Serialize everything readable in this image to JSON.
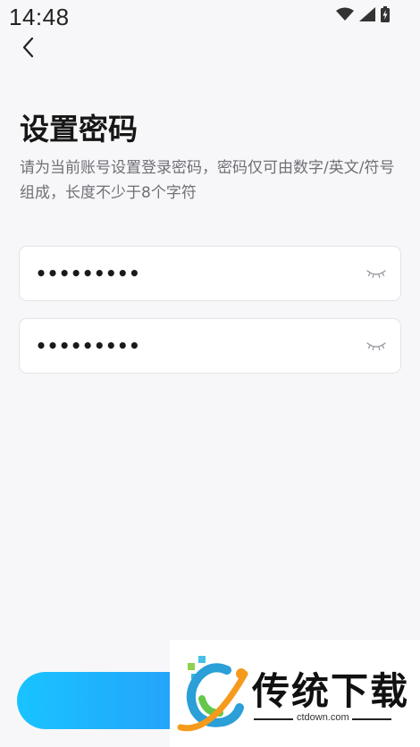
{
  "status_bar": {
    "time": "14:48",
    "icons": [
      "wifi-icon",
      "cell-signal-icon",
      "battery-icon"
    ]
  },
  "nav": {
    "back_icon": "chevron-left-icon"
  },
  "page": {
    "title": "设置密码",
    "description": "请为当前账号设置登录密码，密码仅可由数字/英文/符号组成，长度不少于8个字符"
  },
  "form": {
    "password_field": {
      "value": "•••••••••",
      "toggle_icon": "eye-closed-icon"
    },
    "confirm_password_field": {
      "value": "•••••••••",
      "toggle_icon": "eye-closed-icon"
    }
  },
  "watermark": {
    "text": "传统下载",
    "url": "ctdown.com"
  },
  "colors": {
    "background": "#f7f7f9",
    "button_gradient_start": "#19c3ff",
    "button_gradient_end": "#2f86f6",
    "title": "#161616",
    "description": "#6f6f76"
  }
}
